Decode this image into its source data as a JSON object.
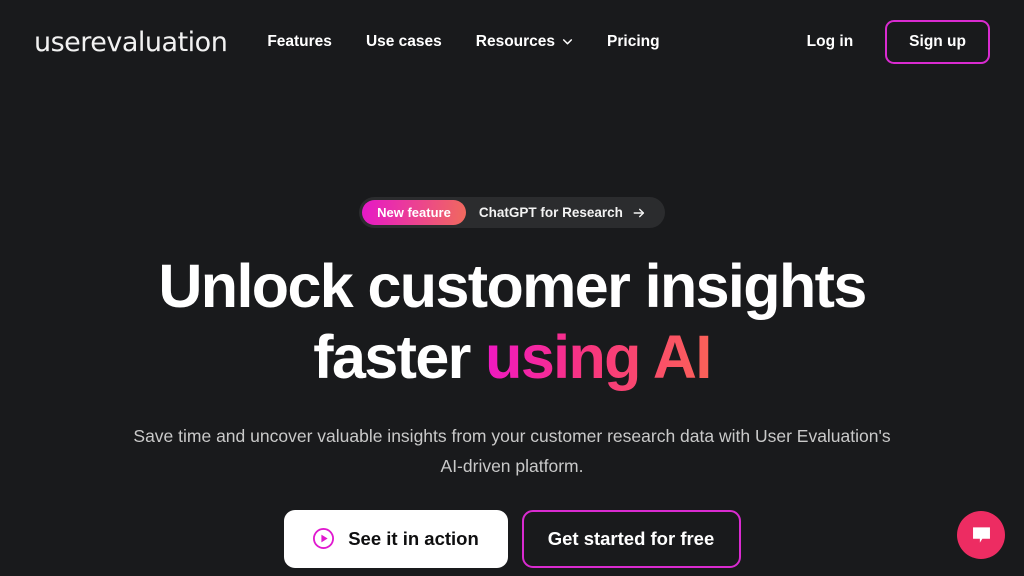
{
  "theme": {
    "background": "#191A1C",
    "accent_magenta": "#D92BD0",
    "gradient_start": "#E618C8",
    "gradient_end": "#F06A5D",
    "chat_pink": "#ED2C62"
  },
  "navbar": {
    "logo": "userevaluation",
    "links": [
      {
        "label": "Features",
        "has_chevron": false,
        "icon": ""
      },
      {
        "label": "Use cases",
        "has_chevron": false,
        "icon": ""
      },
      {
        "label": "Resources",
        "has_chevron": true,
        "icon": "chevron-down-icon"
      },
      {
        "label": "Pricing",
        "has_chevron": false,
        "icon": ""
      }
    ],
    "login_label": "Log in",
    "signup_label": "Sign up"
  },
  "hero": {
    "badge": {
      "pill_label": "New feature",
      "text": "ChatGPT for Research",
      "arrow_icon": "arrow-right-icon"
    },
    "headline_line1": "Unlock customer insights",
    "headline_line2_plain": "faster ",
    "headline_line2_gradient": "using AI",
    "subtitle": "Save time and uncover valuable insights from your customer research data with User Evaluation's AI-driven platform.",
    "cta_primary": {
      "label": "See it in action",
      "icon": "play-circle-icon"
    },
    "cta_secondary": {
      "label": "Get started for free"
    }
  },
  "chat_widget": {
    "icon": "chat-bubble-icon",
    "label": "Open chat"
  }
}
